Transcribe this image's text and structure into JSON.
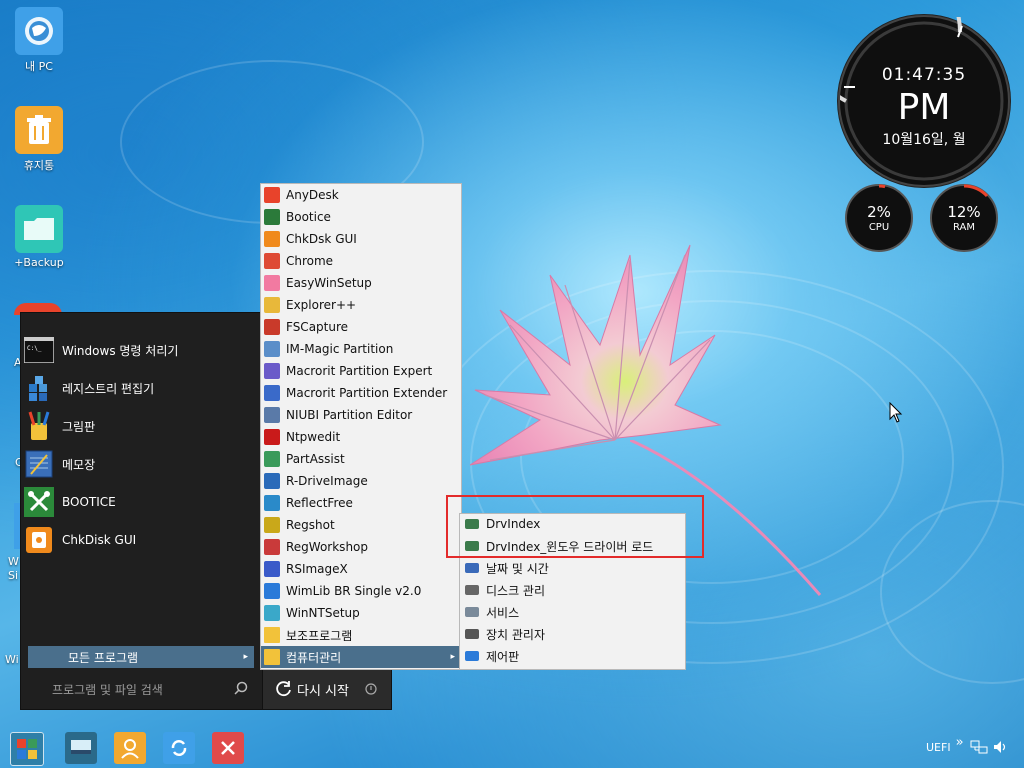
{
  "desktop": {
    "icons": [
      {
        "label": "내 PC",
        "icon": "my-pc-icon"
      },
      {
        "label": "휴지통",
        "icon": "recycle-bin-icon"
      },
      {
        "label": "+Backup",
        "icon": "folder-icon"
      }
    ],
    "partial_labels": [
      "A",
      "C",
      "W",
      "Si",
      "Wi"
    ]
  },
  "clock": {
    "time": "01:47:35",
    "ampm": "PM",
    "date": "10월16일, 월",
    "cpu_value": "2%",
    "cpu_label": "CPU",
    "ram_value": "12%",
    "ram_label": "RAM",
    "cpu_percent": 2,
    "ram_percent": 12
  },
  "start_menu": {
    "pinned": [
      {
        "label": "Windows 명령 처리기",
        "icon": "cmd-icon"
      },
      {
        "label": "레지스트리 편집기",
        "icon": "regedit-icon"
      },
      {
        "label": "그림판",
        "icon": "paint-icon"
      },
      {
        "label": "메모장",
        "icon": "notepad-icon"
      },
      {
        "label": "BOOTICE",
        "icon": "bootice-icon"
      },
      {
        "label": "ChkDisk GUI",
        "icon": "chkdisk-icon"
      }
    ],
    "all_programs": "모든 프로그램",
    "search_placeholder": "프로그램 및 파일 검색",
    "restart": "다시 시작"
  },
  "programs": [
    {
      "label": "AnyDesk",
      "icon": "anydesk-icon",
      "color": "#e8432b"
    },
    {
      "label": "Bootice",
      "icon": "bootice-icon",
      "color": "#2b7a3a"
    },
    {
      "label": "ChkDsk GUI",
      "icon": "chkdsk-icon",
      "color": "#f08a1c"
    },
    {
      "label": "Chrome",
      "icon": "chrome-icon",
      "color": "#de4a35"
    },
    {
      "label": "EasyWinSetup",
      "icon": "easywinsetup-icon",
      "color": "#f27aa1"
    },
    {
      "label": "Explorer++",
      "icon": "explorer-icon",
      "color": "#e8b83a"
    },
    {
      "label": "FSCapture",
      "icon": "fscapture-icon",
      "color": "#c93a2a"
    },
    {
      "label": "IM-Magic Partition",
      "icon": "partition-icon",
      "color": "#5a8ec9"
    },
    {
      "label": "Macrorit Partition Expert",
      "icon": "macrorit-icon",
      "color": "#6a5ac9"
    },
    {
      "label": "Macrorit Partition Extender",
      "icon": "macrorit-extender-icon",
      "color": "#3a6ac9"
    },
    {
      "label": "NIUBI Partition Editor",
      "icon": "niubi-icon",
      "color": "#5a7aa8"
    },
    {
      "label": "Ntpwedit",
      "icon": "ntpwedit-icon",
      "color": "#c91a1a"
    },
    {
      "label": "PartAssist",
      "icon": "partassist-icon",
      "color": "#3a9a5a"
    },
    {
      "label": "R-DriveImage",
      "icon": "rdrive-icon",
      "color": "#2a6ab9"
    },
    {
      "label": "ReflectFree",
      "icon": "reflect-icon",
      "color": "#2a8ac9"
    },
    {
      "label": "Regshot",
      "icon": "regshot-icon",
      "color": "#c9a81a"
    },
    {
      "label": "RegWorkshop",
      "icon": "regworkshop-icon",
      "color": "#c93a3a"
    },
    {
      "label": "RSImageX",
      "icon": "rsimagex-icon",
      "color": "#3a5ac9"
    },
    {
      "label": "WimLib BR Single v2.0",
      "icon": "wimlib-icon",
      "color": "#2a7ad9"
    },
    {
      "label": "WinNTSetup",
      "icon": "winntsetup-icon",
      "color": "#3aa8c9"
    },
    {
      "label": "보조프로그램",
      "icon": "folder-icon",
      "color": "#f2c23a"
    },
    {
      "label": "컴퓨터관리",
      "icon": "folder-icon",
      "color": "#f2c23a"
    }
  ],
  "computer_management": [
    {
      "label": "DrvIndex",
      "icon": "drvindex-icon"
    },
    {
      "label": "DrvIndex_윈도우 드라이버 로드",
      "icon": "drvindex-icon"
    },
    {
      "label": "날짜 및 시간",
      "icon": "calendar-icon"
    },
    {
      "label": "디스크 관리",
      "icon": "disk-icon"
    },
    {
      "label": "서비스",
      "icon": "services-icon"
    },
    {
      "label": "장치 관리자",
      "icon": "device-manager-icon"
    },
    {
      "label": "제어판",
      "icon": "control-panel-icon"
    }
  ],
  "taskbar": {
    "buttons": [
      "start-button",
      "desktop-button",
      "user-button",
      "refresh-button",
      "close-button"
    ],
    "tray_text": "UEFI",
    "tray_chevron": "»"
  }
}
